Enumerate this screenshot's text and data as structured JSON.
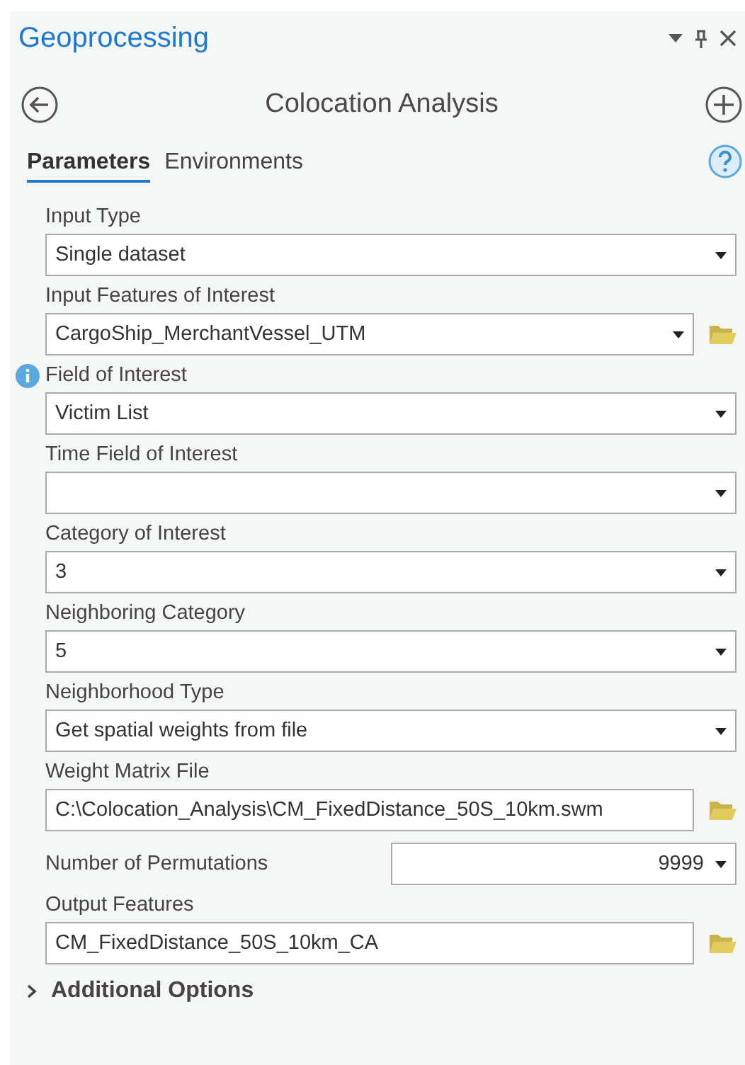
{
  "pane": {
    "title": "Geoprocessing"
  },
  "tool": {
    "title": "Colocation Analysis"
  },
  "tabs": [
    {
      "label": "Parameters",
      "selected": true
    },
    {
      "label": "Environments",
      "selected": false
    }
  ],
  "parameters": [
    {
      "kind": "dropdown",
      "label": "Input Type",
      "value": "Single dataset",
      "info": false
    },
    {
      "kind": "dropdown-browse",
      "label": "Input Features of Interest",
      "value": "CargoShip_MerchantVessel_UTM",
      "info": false
    },
    {
      "kind": "dropdown",
      "label": "Field of Interest",
      "value": "Victim List",
      "info": true
    },
    {
      "kind": "dropdown",
      "label": "Time Field of Interest",
      "info": false
    },
    {
      "kind": "dropdown",
      "label": "Category of Interest",
      "value": "3",
      "info": false
    },
    {
      "kind": "dropdown",
      "label": "Neighboring Category",
      "value": "5",
      "info": false
    },
    {
      "kind": "dropdown",
      "label": "Neighborhood Type",
      "value": "Get spatial weights from file",
      "info": false
    },
    {
      "kind": "text-browse",
      "label": "Weight Matrix File",
      "value": "C:\\Colocation_Analysis\\CM_FixedDistance_50S_10km.swm",
      "info": false
    },
    {
      "kind": "inline-dropdown",
      "label": "Number of Permutations",
      "value": "9999",
      "info": false
    },
    {
      "kind": "text-browse",
      "label": "Output Features",
      "value": "CM_FixedDistance_50S_10km_CA",
      "info": false
    }
  ],
  "section": {
    "label": "Additional Options",
    "expanded": false
  }
}
